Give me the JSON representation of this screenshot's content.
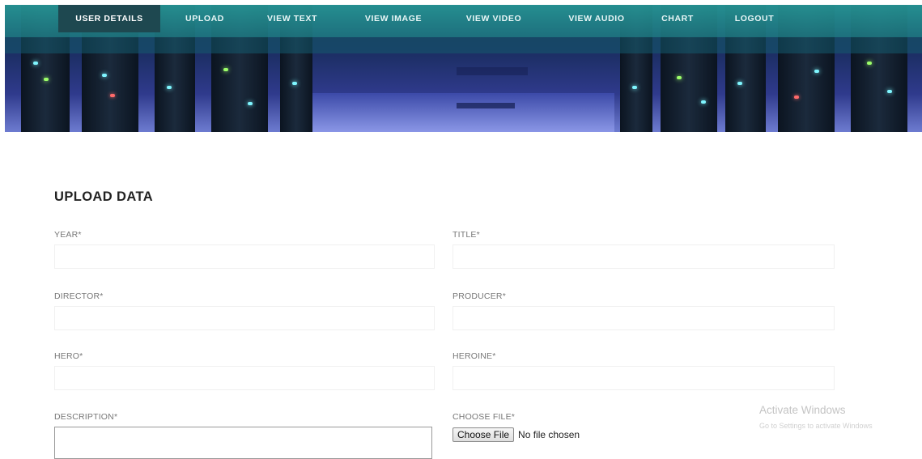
{
  "nav": {
    "items": [
      {
        "label": "USER DETAILS"
      },
      {
        "label": "UPLOAD"
      },
      {
        "label": "VIEW TEXT"
      },
      {
        "label": "VIEW IMAGE"
      },
      {
        "label": "VIEW VIDEO"
      },
      {
        "label": "VIEW AUDIO"
      },
      {
        "label": "CHART"
      },
      {
        "label": "LOGOUT"
      }
    ],
    "active": "USER DETAILS"
  },
  "form": {
    "heading": "UPLOAD DATA",
    "year_label": "YEAR*",
    "title_label": "TITLE*",
    "director_label": "DIRECTOR*",
    "producer_label": "PRODUCER*",
    "hero_label": "HERO*",
    "heroine_label": "HEROINE*",
    "description_label": "DESCRIPTION*",
    "choose_file_label": "CHOOSE FILE*",
    "file_button": "Choose File",
    "file_status": "No file chosen"
  },
  "watermark": {
    "line1": "Activate Windows",
    "line2": "Go to Settings to activate Windows"
  },
  "colors": {
    "nav_bg": "#2a9696",
    "nav_active": "#1e4850",
    "banner": "#1d2f66"
  }
}
